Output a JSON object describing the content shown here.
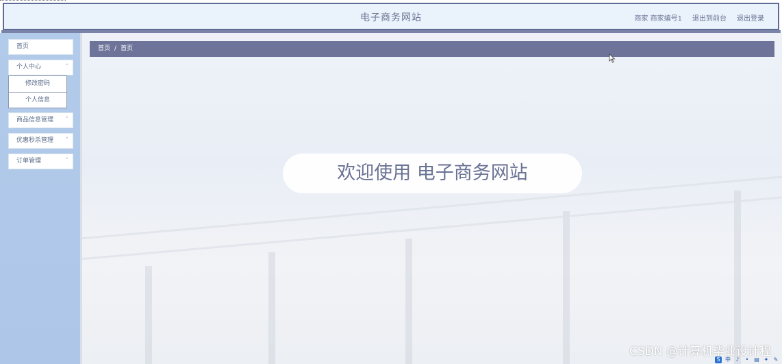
{
  "header": {
    "site_title": "电子商务网站",
    "user_role": "商家",
    "user_name": "商家编号1",
    "back_to_front": "退出到前台",
    "logout": "退出登录"
  },
  "sidebar": {
    "items": [
      {
        "label": "首页"
      },
      {
        "label": "个人中心",
        "expanded": true,
        "children": [
          {
            "label": "修改密码"
          },
          {
            "label": "个人信息"
          }
        ]
      },
      {
        "label": "商品信息管理"
      },
      {
        "label": "优惠秒杀管理"
      },
      {
        "label": "订单管理"
      }
    ],
    "chevron": "˅"
  },
  "breadcrumb": {
    "items": [
      "首页",
      "首页"
    ],
    "separator": "/"
  },
  "welcome": {
    "text": "欢迎使用 电子商务网站"
  },
  "watermark": "CSDN @计算机毕业设计程",
  "tray": {
    "items": [
      "S",
      "中",
      "♪",
      "•",
      "▤",
      "✦",
      "✎"
    ]
  },
  "colors": {
    "accent": "#6d7399",
    "sidebar_bg": "#b3cbea",
    "header_bg": "#eaf3fb",
    "text": "#6a7294"
  },
  "icons": {
    "cursor": "mouse-pointer-icon",
    "chevron": "chevron-down-icon"
  }
}
